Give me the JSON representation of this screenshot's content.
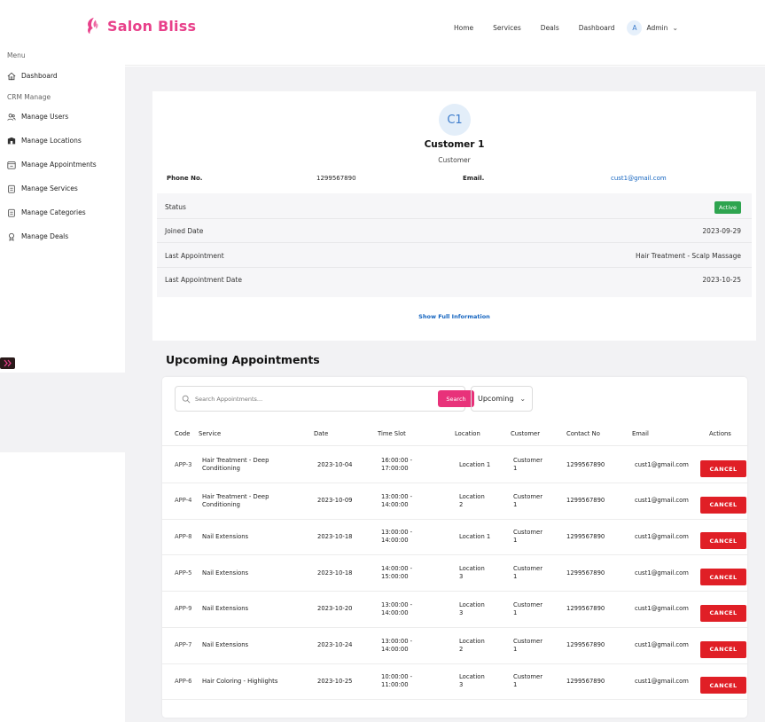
{
  "brand": {
    "name": "Salon Bliss",
    "color": "#e8408a"
  },
  "topnav": {
    "links": [
      "Home",
      "Services",
      "Deals",
      "Dashboard"
    ],
    "avatar_initial": "A",
    "user_label": "Admin"
  },
  "sidebar": {
    "menu_heading": "Menu",
    "dashboard_label": "Dashboard",
    "crm_heading": "CRM Manage",
    "items": [
      {
        "label": "Manage Users",
        "icon": "users-icon"
      },
      {
        "label": "Manage Locations",
        "icon": "location-icon"
      },
      {
        "label": "Manage Appointments",
        "icon": "calendar-icon"
      },
      {
        "label": "Manage Services",
        "icon": "clipboard-icon"
      },
      {
        "label": "Manage Categories",
        "icon": "clipboard-icon"
      },
      {
        "label": "Manage Deals",
        "icon": "award-icon"
      }
    ]
  },
  "customer": {
    "initials": "C1",
    "name": "Customer 1",
    "role": "Customer",
    "phone_label": "Phone No.",
    "phone": "1299567890",
    "email_label": "Email.",
    "email": "cust1@gmail.com",
    "status_label": "Status",
    "status": "Active",
    "joined_label": "Joined Date",
    "joined": "2023-09-29",
    "last_appt_label": "Last Appointment",
    "last_appt": "Hair Treatment - Scalp Massage",
    "last_appt_date_label": "Last Appointment Date",
    "last_appt_date": "2023-10-25",
    "show_full": "Show Full Information"
  },
  "appointments": {
    "title": "Upcoming Appointments",
    "search_placeholder": "Search Appointments...",
    "search_button": "Search",
    "filter_value": "Upcoming",
    "columns": [
      "Code",
      "Service",
      "Date",
      "Time Slot",
      "Location",
      "Customer",
      "Contact No",
      "Email",
      "Actions"
    ],
    "cancel_label": "CANCEL",
    "rows": [
      {
        "code": "APP-3",
        "service": [
          "Hair Treatment - Deep",
          "Conditioning"
        ],
        "date": "2023-10-04",
        "time": [
          "16:00:00 -",
          "17:00:00"
        ],
        "location": [
          "Location 1"
        ],
        "customer": [
          "Customer",
          "1"
        ],
        "contact": "1299567890",
        "email": "cust1@gmail.com"
      },
      {
        "code": "APP-4",
        "service": [
          "Hair Treatment - Deep",
          "Conditioning"
        ],
        "date": "2023-10-09",
        "time": [
          "13:00:00 -",
          "14:00:00"
        ],
        "location": [
          "Location",
          "2"
        ],
        "customer": [
          "Customer",
          "1"
        ],
        "contact": "1299567890",
        "email": "cust1@gmail.com"
      },
      {
        "code": "APP-8",
        "service": [
          "Nail Extensions"
        ],
        "date": "2023-10-18",
        "time": [
          "13:00:00 -",
          "14:00:00"
        ],
        "location": [
          "Location 1"
        ],
        "customer": [
          "Customer",
          "1"
        ],
        "contact": "1299567890",
        "email": "cust1@gmail.com"
      },
      {
        "code": "APP-5",
        "service": [
          "Nail Extensions"
        ],
        "date": "2023-10-18",
        "time": [
          "14:00:00 -",
          "15:00:00"
        ],
        "location": [
          "Location",
          "3"
        ],
        "customer": [
          "Customer",
          "1"
        ],
        "contact": "1299567890",
        "email": "cust1@gmail.com"
      },
      {
        "code": "APP-9",
        "service": [
          "Nail Extensions"
        ],
        "date": "2023-10-20",
        "time": [
          "13:00:00 -",
          "14:00:00"
        ],
        "location": [
          "Location",
          "3"
        ],
        "customer": [
          "Customer",
          "1"
        ],
        "contact": "1299567890",
        "email": "cust1@gmail.com"
      },
      {
        "code": "APP-7",
        "service": [
          "Nail Extensions"
        ],
        "date": "2023-10-24",
        "time": [
          "13:00:00 -",
          "14:00:00"
        ],
        "location": [
          "Location",
          "2"
        ],
        "customer": [
          "Customer",
          "1"
        ],
        "contact": "1299567890",
        "email": "cust1@gmail.com"
      },
      {
        "code": "APP-6",
        "service": [
          "Hair Coloring - Highlights"
        ],
        "date": "2023-10-25",
        "time": [
          "10:00:00 -",
          "11:00:00"
        ],
        "location": [
          "Location",
          "3"
        ],
        "customer": [
          "Customer",
          "1"
        ],
        "contact": "1299567890",
        "email": "cust1@gmail.com"
      }
    ]
  },
  "colors": {
    "accent": "#e8327a",
    "danger": "#e01f26",
    "success": "#2ea44f",
    "link": "#1565c0"
  }
}
